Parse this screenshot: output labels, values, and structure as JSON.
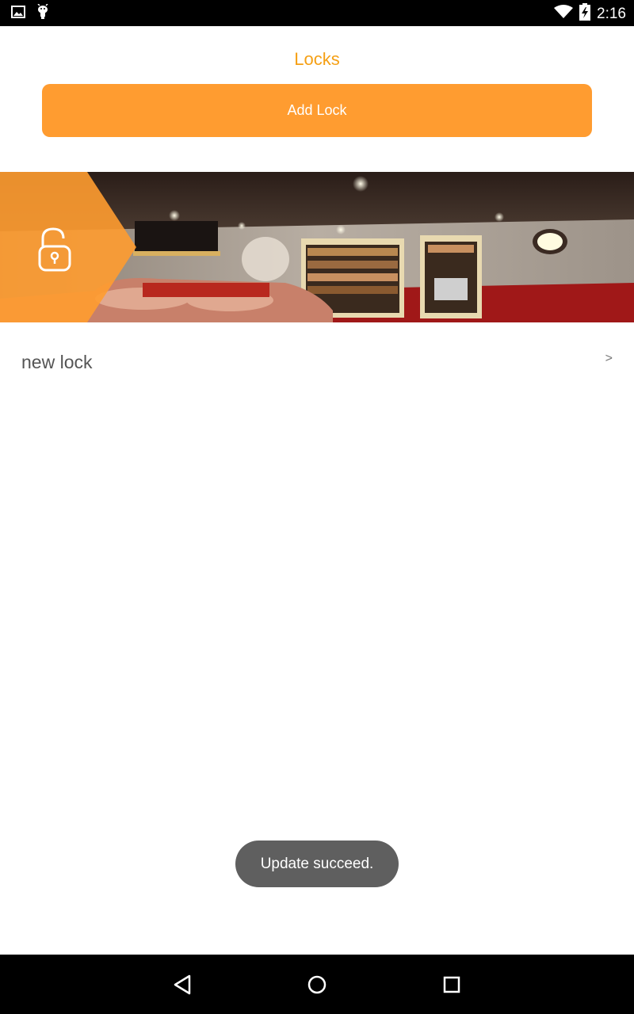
{
  "status_bar": {
    "time": "2:16",
    "icons": [
      "gallery-icon",
      "android-icon",
      "wifi-icon",
      "battery-charging-icon"
    ]
  },
  "header": {
    "title": "Locks",
    "add_button_label": "Add Lock"
  },
  "banner": {
    "badge_icon": "unlocked-padlock-icon"
  },
  "list": {
    "items": [
      {
        "label": "new lock",
        "chevron": ">"
      }
    ]
  },
  "toast": {
    "message": "Update succeed."
  },
  "nav_bar": {
    "buttons": [
      "back-icon",
      "home-icon",
      "recents-icon"
    ]
  },
  "colors": {
    "accent": "#FF9C30",
    "title": "#F5A015",
    "toast_bg": "#5f5f5f"
  }
}
